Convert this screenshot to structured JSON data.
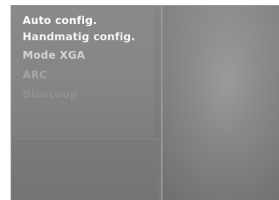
{
  "menu": {
    "items": [
      {
        "label": "Auto config."
      },
      {
        "label": "Handmatig config."
      },
      {
        "label": "Mode XGA"
      },
      {
        "label": "ARC"
      },
      {
        "label": "Bioscoop"
      }
    ]
  }
}
